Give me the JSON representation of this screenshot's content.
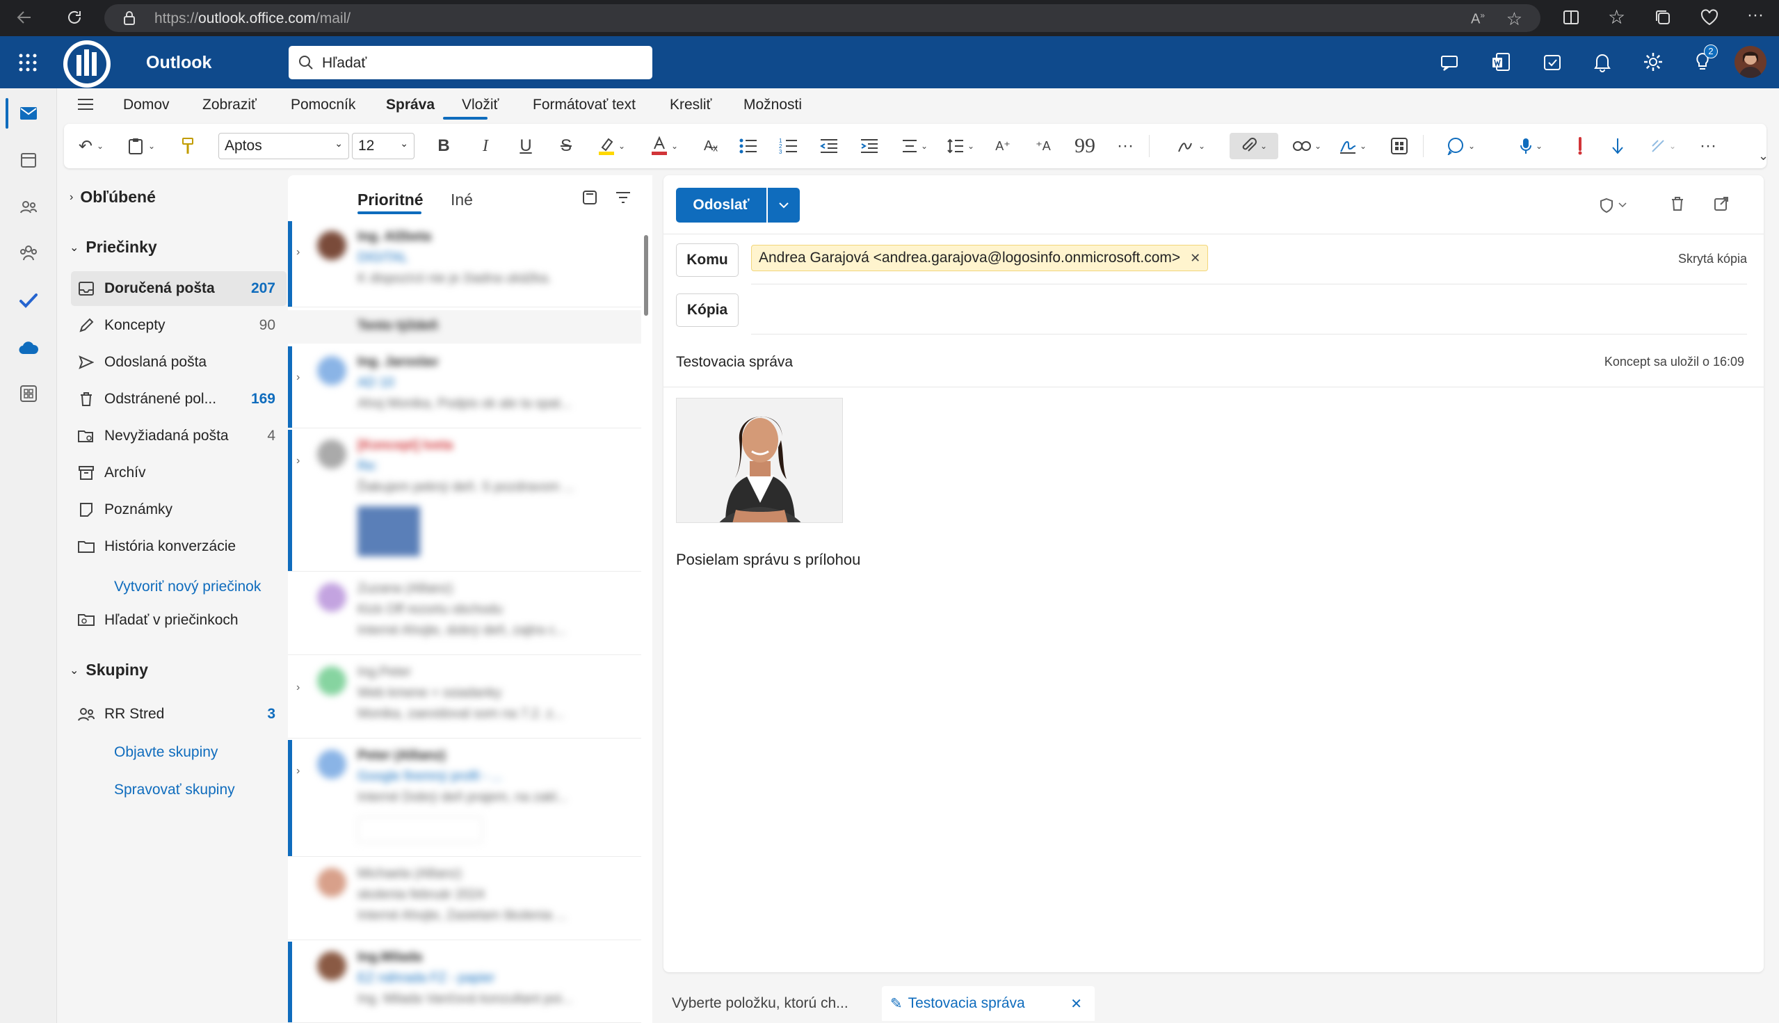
{
  "browser": {
    "url_prefix": "https://",
    "url_host": "outlook.office.com",
    "url_path": "/mail/"
  },
  "suite": {
    "app_name": "Outlook",
    "search_placeholder": "Hľadať",
    "notification_badge": "2"
  },
  "ribbon": {
    "tabs": [
      "Domov",
      "Zobraziť",
      "Pomocník",
      "Správa",
      "Vložiť",
      "Formátovať text",
      "Kresliť",
      "Možnosti"
    ],
    "active_tab": "Správa",
    "font_name": "Aptos",
    "font_size": "12"
  },
  "folders": {
    "favorites_label": "Obľúbené",
    "folders_label": "Priečinky",
    "items": [
      {
        "label": "Doručená pošta",
        "count": "207"
      },
      {
        "label": "Koncepty",
        "count": "90"
      },
      {
        "label": "Odoslaná pošta",
        "count": ""
      },
      {
        "label": "Odstránené pol...",
        "count": "169"
      },
      {
        "label": "Nevyžiadaná pošta",
        "count": "4"
      },
      {
        "label": "Archív",
        "count": ""
      },
      {
        "label": "Poznámky",
        "count": ""
      },
      {
        "label": "História konverzácie",
        "count": ""
      }
    ],
    "new_folder_link": "Vytvoriť nový priečinok",
    "search_folders": "Hľadať v priečinkoch",
    "groups_label": "Skupiny",
    "group_items": [
      {
        "label": "RR Stred",
        "count": "3"
      }
    ],
    "discover_groups": "Objavte skupiny",
    "manage_groups": "Spravovať skupiny"
  },
  "message_list": {
    "tab_focused": "Prioritné",
    "tab_other": "Iné",
    "week_header": "Tento týždeň",
    "messages": [
      {
        "l1": "Ing. Alžbeta",
        "l2": "DIGITAL",
        "l3": "K dispozícii nie je žiadna ukážka."
      },
      {
        "l1": "Ing. Jaroslav",
        "l2": "AD 10",
        "l3": "Ahoj Monika, Podpis ok ale ta spat..."
      },
      {
        "l1": "[Koncept] Iveta",
        "l2": "Re:",
        "l3": "Ďakujem pekný deň. S pozdravom ..."
      },
      {
        "l1": "Zuzana (Allianz)",
        "l2": "Kick Off rezortu obchodu",
        "l3": "Interné Ahojte, dobrý deň, zajtra c..."
      },
      {
        "l1": "Ing.Peter",
        "l2": "Web kmene + ssiadanky",
        "l3": "Monika, zaevidoval som na 7.2. z..."
      },
      {
        "l1": "Peter (Allianz)",
        "l2": "Google firemný profil - ...",
        "l3": "Interné Dobrý deň prajem, na zakl..."
      },
      {
        "l1": "Michaela (Allianz)",
        "l2": "skolenia február 2024",
        "l3": "Interné Ahojte, Zasielam školenia ..."
      },
      {
        "l1": "Ing.Milada",
        "l2": "EZ náhrada FZ - papier",
        "l3": "Ing. Milada Vančová konzultant poi..."
      }
    ]
  },
  "compose": {
    "send_label": "Odoslať",
    "to_label": "Komu",
    "cc_label": "Kópia",
    "bcc_label": "Skrytá kópia",
    "recipient": "Andrea Garajová <andrea.garajova@logosinfo.onmicrosoft.com>",
    "subject": "Testovacia správa",
    "draft_saved": "Koncept sa uložil o 16:09",
    "body": "Posielam správu s prílohou"
  },
  "bottom_tabs": {
    "tab1": "Vyberte položku, ktorú ch...",
    "tab2": "Testovacia správa"
  },
  "colors": {
    "suite_bar": "#0f4a8c",
    "accent": "#0f6cbd",
    "chip_bg": "#fff4ce"
  }
}
